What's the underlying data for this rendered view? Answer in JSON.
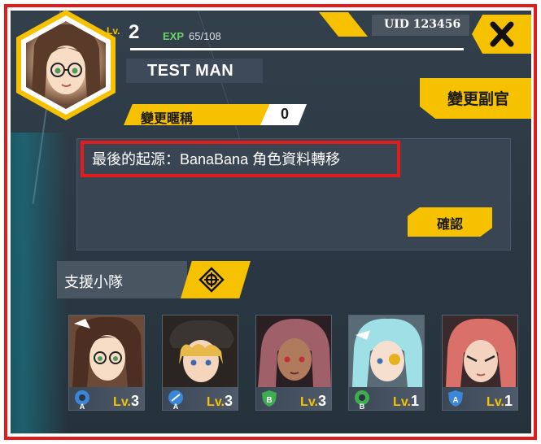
{
  "profile": {
    "level_label": "Lv.",
    "level": "2",
    "exp_label": "EXP",
    "exp_value": "65/108",
    "name": "TEST MAN",
    "uid": "UID 123456"
  },
  "nickname": {
    "label": "變更暱稱",
    "count": "0"
  },
  "buttons": {
    "deputy": "變更副官",
    "confirm": "確認"
  },
  "message": {
    "text": "最後的起源：BanaBana 角色資料轉移"
  },
  "support": {
    "label": "支援小隊",
    "members": [
      {
        "lv_label": "Lv.",
        "level": "3",
        "class_icon": "gear-a-icon",
        "badge_color": "#3a86d8"
      },
      {
        "lv_label": "Lv.",
        "level": "3",
        "class_icon": "gear-a-icon",
        "badge_color": "#3a86d8"
      },
      {
        "lv_label": "Lv.",
        "level": "3",
        "class_icon": "shield-b-icon",
        "badge_color": "#3cae4f"
      },
      {
        "lv_label": "Lv.",
        "level": "1",
        "class_icon": "gear-b-icon",
        "badge_color": "#3cae4f"
      },
      {
        "lv_label": "Lv.",
        "level": "1",
        "class_icon": "shield-a-icon",
        "badge_color": "#3a86d8"
      }
    ]
  },
  "colors": {
    "accent": "#f6c200",
    "highlight": "#e41b1b",
    "panel": "#2f3c48"
  }
}
